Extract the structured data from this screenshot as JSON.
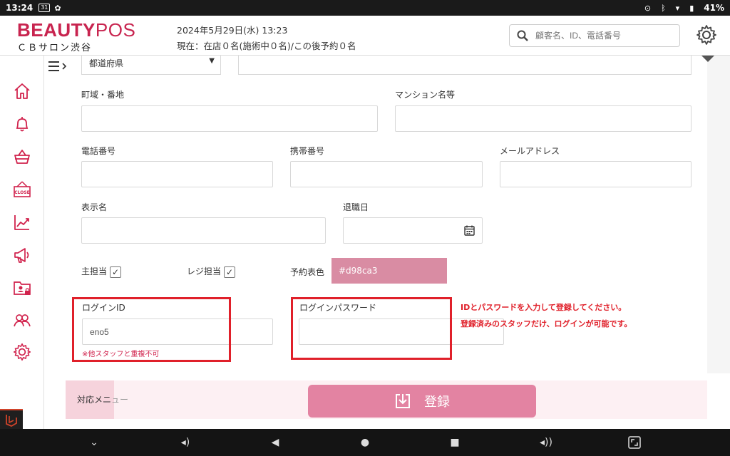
{
  "status_bar": {
    "time": "13:24",
    "calendar": "31",
    "battery": "41%"
  },
  "header": {
    "brand_main": "BEAUTY",
    "brand_accent": "POS",
    "shop_name": "ＣＢサロン渋谷",
    "datetime": "2024年5月29日(水) 13:23",
    "status_line": "現在：在店０名(施術中０名)/この後予約０名",
    "search_placeholder": "顧客名、ID、電話番号"
  },
  "sidebar": {
    "items": [
      "home-icon",
      "bell-icon",
      "basket-icon",
      "close-sign-icon",
      "chart-icon",
      "megaphone-icon",
      "folder-lock-icon",
      "users-icon",
      "gear-icon"
    ]
  },
  "form": {
    "prefecture_select": "都道府県",
    "town_label": "町域・番地",
    "building_label": "マンション名等",
    "phone_label": "電話番号",
    "mobile_label": "携帯番号",
    "email_label": "メールアドレス",
    "display_name_label": "表示名",
    "retire_date_label": "退職日",
    "main_staff_label": "主担当",
    "main_staff_checked": true,
    "register_staff_label": "レジ担当",
    "register_staff_checked": true,
    "color_label": "予約表色",
    "color_value": "#d98ca3",
    "login_id_label": "ログインID",
    "login_id_value": "eno5",
    "login_id_note": "※他スタッフと重複不可",
    "password_label": "ログインパスワード",
    "password_value": "",
    "annotation_line1": "IDとパスワードを入力して登録してください。",
    "annotation_line2": "登録済みのスタッフだけ、ログインが可能です。"
  },
  "bottom": {
    "menu_label_visible": "対応メニ",
    "menu_label_faded": "ュー",
    "register_button": "登録"
  },
  "colors": {
    "brand": "#c8244f",
    "accent_button": "#e383a2",
    "annotation_red": "#e0202a",
    "reservation_color": "#d98ca3"
  }
}
